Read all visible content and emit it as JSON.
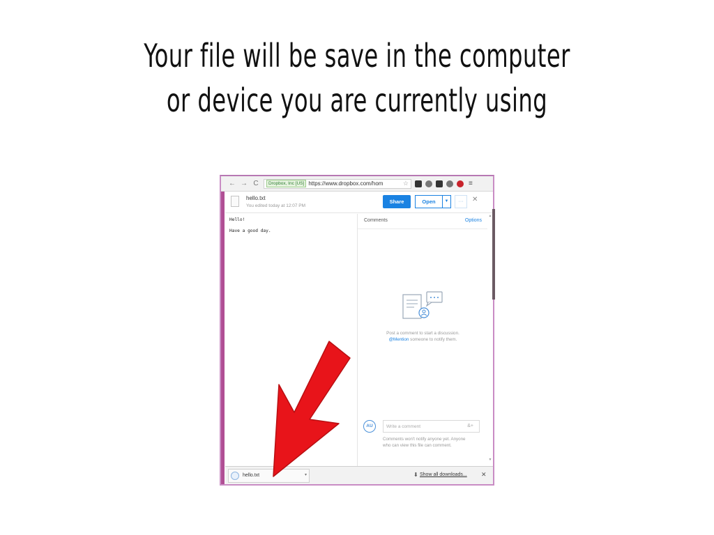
{
  "slide": {
    "title_line1": "Your file will be save in the computer",
    "title_line2": "or device you are currently using"
  },
  "browser": {
    "nav": {
      "back": "←",
      "forward": "→",
      "reload": "C"
    },
    "certificate": "Dropbox, Inc [US]",
    "url": "https://www.dropbox.com/hom",
    "star": "☆",
    "menu": "≡"
  },
  "file": {
    "name": "hello.txt",
    "edited": "You edited today at 12:07 PM",
    "share_label": "Share",
    "open_label": "Open",
    "open_caret": "▼",
    "more_label": "···",
    "close_label": "✕",
    "content_lines": [
      "Hello!",
      "Have a good day."
    ]
  },
  "comments": {
    "title": "Comments",
    "options": "Options",
    "empty_line1": "Post a comment to start a discussion.",
    "empty_mention": "@Mention",
    "empty_line2_rest": " someone to notify them.",
    "avatar": "AU",
    "input_placeholder": "Write a comment",
    "add_person": "&+",
    "notify_note": "Comments won't notify anyone yet. Anyone who can view this file can comment."
  },
  "downloads": {
    "file_name": "hello.txt",
    "caret": "▾",
    "show_all": "Show all downloads...",
    "arrow": "⬇",
    "close": "✕"
  },
  "colors": {
    "accent": "#1a82e2",
    "arrow_red": "#e8141a",
    "frame_pink": "#c98cc4"
  }
}
